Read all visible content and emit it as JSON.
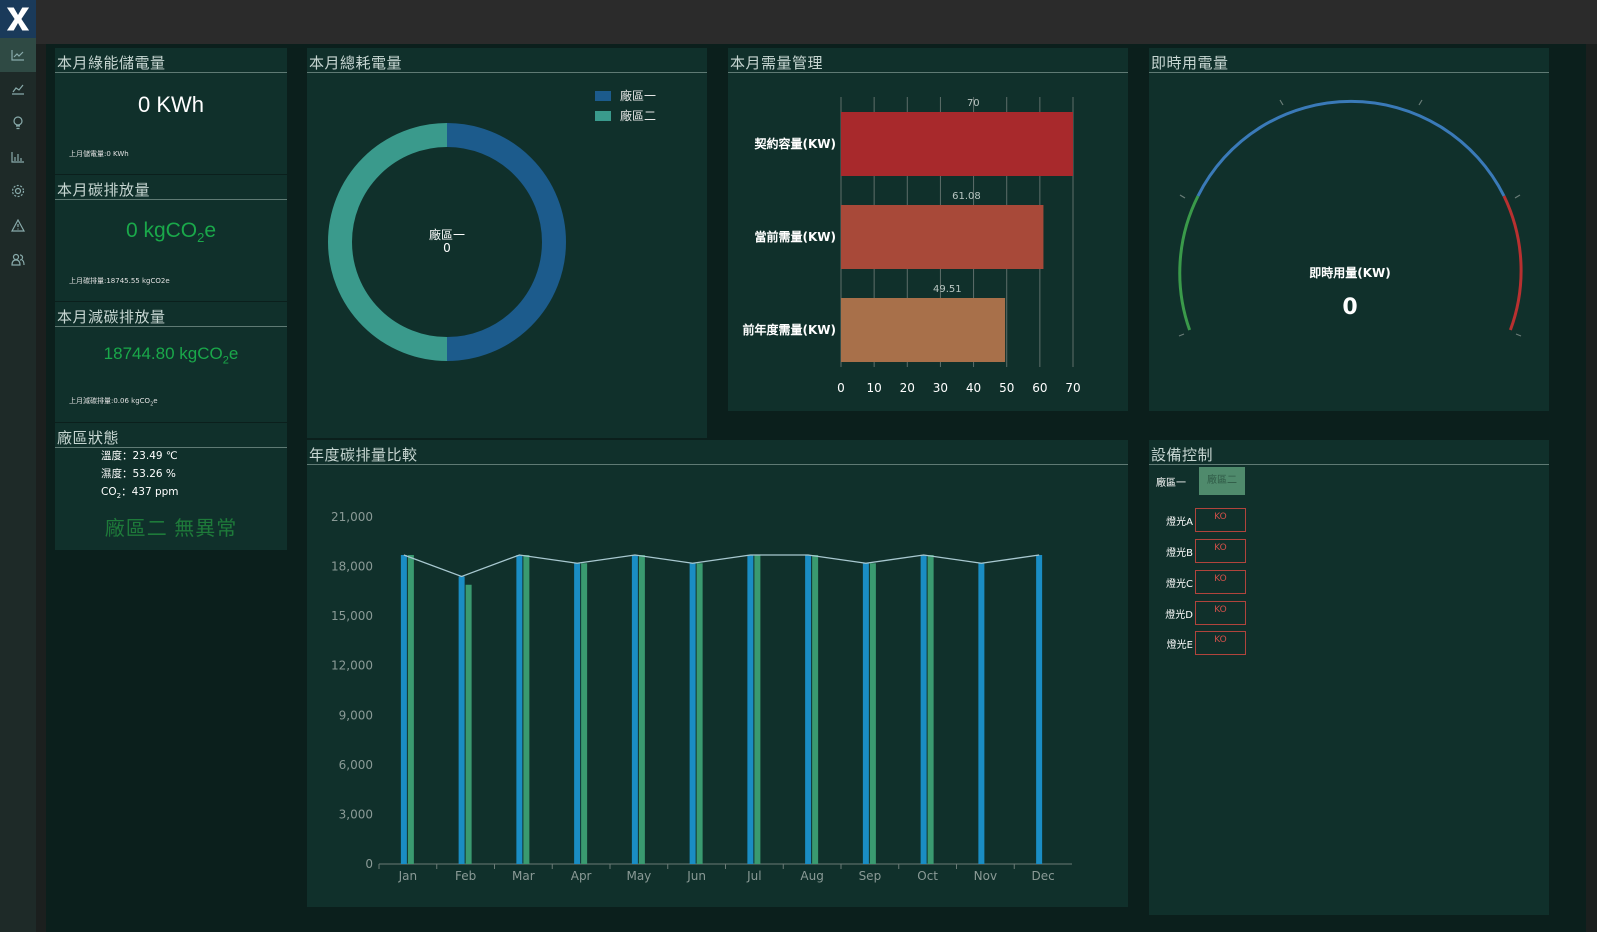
{
  "nav": {
    "logo": "X",
    "items": [
      "dashboard-icon",
      "trend-icon",
      "bulb-icon",
      "bar-chart-icon",
      "gear-icon",
      "warning-icon",
      "users-icon"
    ]
  },
  "green_storage": {
    "title": "本月綠能儲電量",
    "value": "0 KWh",
    "last_month": "上月儲電量:0 KWh"
  },
  "carbon_emission": {
    "title": "本月碳排放量",
    "value_pre": "0 kgCO",
    "value_sub": "2",
    "value_post": "e",
    "last_month": "上月碳排量:18745.55 kgCO2e"
  },
  "carbon_reduction": {
    "title": "本月減碳排放量",
    "value_pre": "18744.80 kgCO",
    "value_sub": "2",
    "value_post": "e",
    "last_month_pre": "上月減碳排量:0.06 kgCO",
    "last_month_sub": "2",
    "last_month_post": "e"
  },
  "factory_status": {
    "title": "廠區狀態",
    "temperature": "溫度：23.49 ℃",
    "humidity": "濕度：53.26 %",
    "co2_pre": "CO",
    "co2_sub": "2",
    "co2_post": "：437 ppm",
    "status": "廠區二 無異常"
  },
  "total_consumption": {
    "title": "本月總耗電量",
    "center_label": "廠區一",
    "center_value": "0",
    "legend": [
      {
        "label": "廠區一",
        "color": "#1c5b8c"
      },
      {
        "label": "廠區二",
        "color": "#3a9a8c"
      }
    ]
  },
  "demand": {
    "title": "本月需量管理",
    "chart_data": {
      "type": "bar",
      "orientation": "horizontal",
      "categories": [
        "契約容量(KW)",
        "當前需量(KW)",
        "前年度需量(KW)"
      ],
      "values": [
        70,
        61.08,
        49.51
      ],
      "value_labels": [
        "70",
        "61.08",
        "49.51"
      ],
      "colors": [
        "#a8292c",
        "#a84939",
        "#a8704a"
      ],
      "xlim": [
        0,
        70
      ],
      "ticks": [
        "0",
        "10",
        "20",
        "30",
        "40",
        "50",
        "60",
        "70"
      ]
    }
  },
  "realtime": {
    "title": "即時用電量",
    "label": "即時用量(KW)",
    "value": "0"
  },
  "annual": {
    "title": "年度碳排量比較",
    "chart_data": {
      "type": "bar",
      "categories": [
        "Jan",
        "Feb",
        "Mar",
        "Apr",
        "May",
        "Jun",
        "Jul",
        "Aug",
        "Sep",
        "Oct",
        "Nov",
        "Dec"
      ],
      "series": [
        {
          "values": [
            18700,
            17400,
            18700,
            18200,
            18700,
            18200,
            18700,
            18700,
            18200,
            18700,
            18200,
            18700
          ],
          "color": "#1a8dc4"
        },
        {
          "values": [
            18700,
            16900,
            18700,
            18200,
            18700,
            18200,
            18700,
            18700,
            18200,
            18700,
            null,
            null
          ],
          "color": "#3a9a70"
        }
      ],
      "line": [
        18700,
        17400,
        18700,
        18200,
        18700,
        18200,
        18700,
        18700,
        18200,
        18700,
        18200,
        18700
      ],
      "ylim": [
        0,
        21000
      ],
      "yticks": [
        "0",
        "3,000",
        "6,000",
        "9,000",
        "12,000",
        "15,000",
        "18,000",
        "21,000"
      ]
    }
  },
  "device_control": {
    "title": "設備控制",
    "tab_active": "廠區一",
    "tab_inactive": "廠區二",
    "lights": [
      {
        "label": "燈光A",
        "state": "KO"
      },
      {
        "label": "燈光B",
        "state": "KO"
      },
      {
        "label": "燈光C",
        "state": "KO"
      },
      {
        "label": "燈光D",
        "state": "KO"
      },
      {
        "label": "燈光E",
        "state": "KO"
      }
    ]
  }
}
